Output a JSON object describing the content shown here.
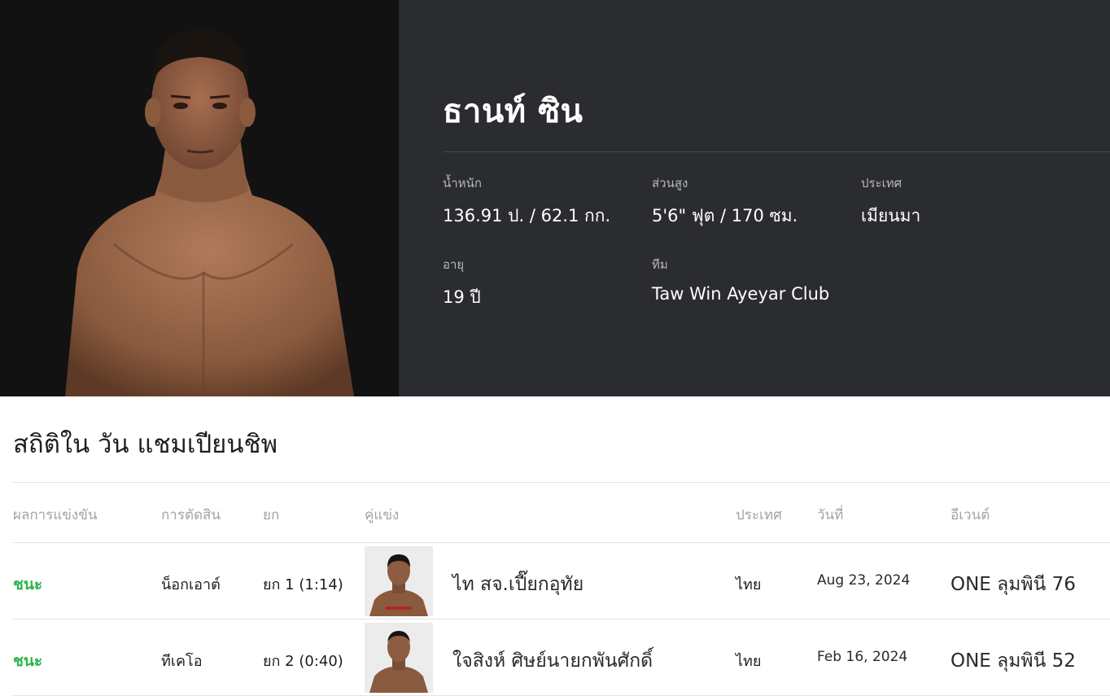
{
  "fighter": {
    "name": "ธานท์ ซิน",
    "photo_alt": "fighter-portrait",
    "stats": {
      "weight": {
        "label": "น้ำหนัก",
        "value": "136.91 ป. / 62.1 กก."
      },
      "height": {
        "label": "ส่วนสูง",
        "value": "5'6\" ฟุต / 170 ซม."
      },
      "country": {
        "label": "ประเทศ",
        "value": "เมียนมา"
      },
      "age": {
        "label": "อายุ",
        "value": "19 ปี"
      },
      "team": {
        "label": "ทีม",
        "value": "Taw Win Ayeyar Club"
      }
    }
  },
  "record": {
    "title": "สถิติใน วัน แชมเปียนชิพ",
    "headers": {
      "result": "ผลการแข่งขัน",
      "method": "การตัดสิน",
      "round": "ยก",
      "opponent": "คู่แข่ง",
      "country": "ประเทศ",
      "date": "วันที่",
      "event": "อีเวนต์"
    },
    "rows": [
      {
        "result": "ชนะ",
        "method": "น็อกเอาต์",
        "round": "ยก 1 (1:14)",
        "opponent": "ไท สจ.เปี๊ยกอุทัย",
        "country": "ไทย",
        "date": "Aug 23, 2024",
        "event": "ONE ลุมพินี 76"
      },
      {
        "result": "ชนะ",
        "method": "ทีเคโอ",
        "round": "ยก 2 (0:40)",
        "opponent": "ใจสิงห์ ศิษย์นายกพันศักดิ์",
        "country": "ไทย",
        "date": "Feb 16, 2024",
        "event": "ONE ลุมพินี 52"
      }
    ]
  },
  "colors": {
    "hero_bg": "#2b2c30",
    "photo_bg": "#121212",
    "win": "#2bb54c"
  }
}
